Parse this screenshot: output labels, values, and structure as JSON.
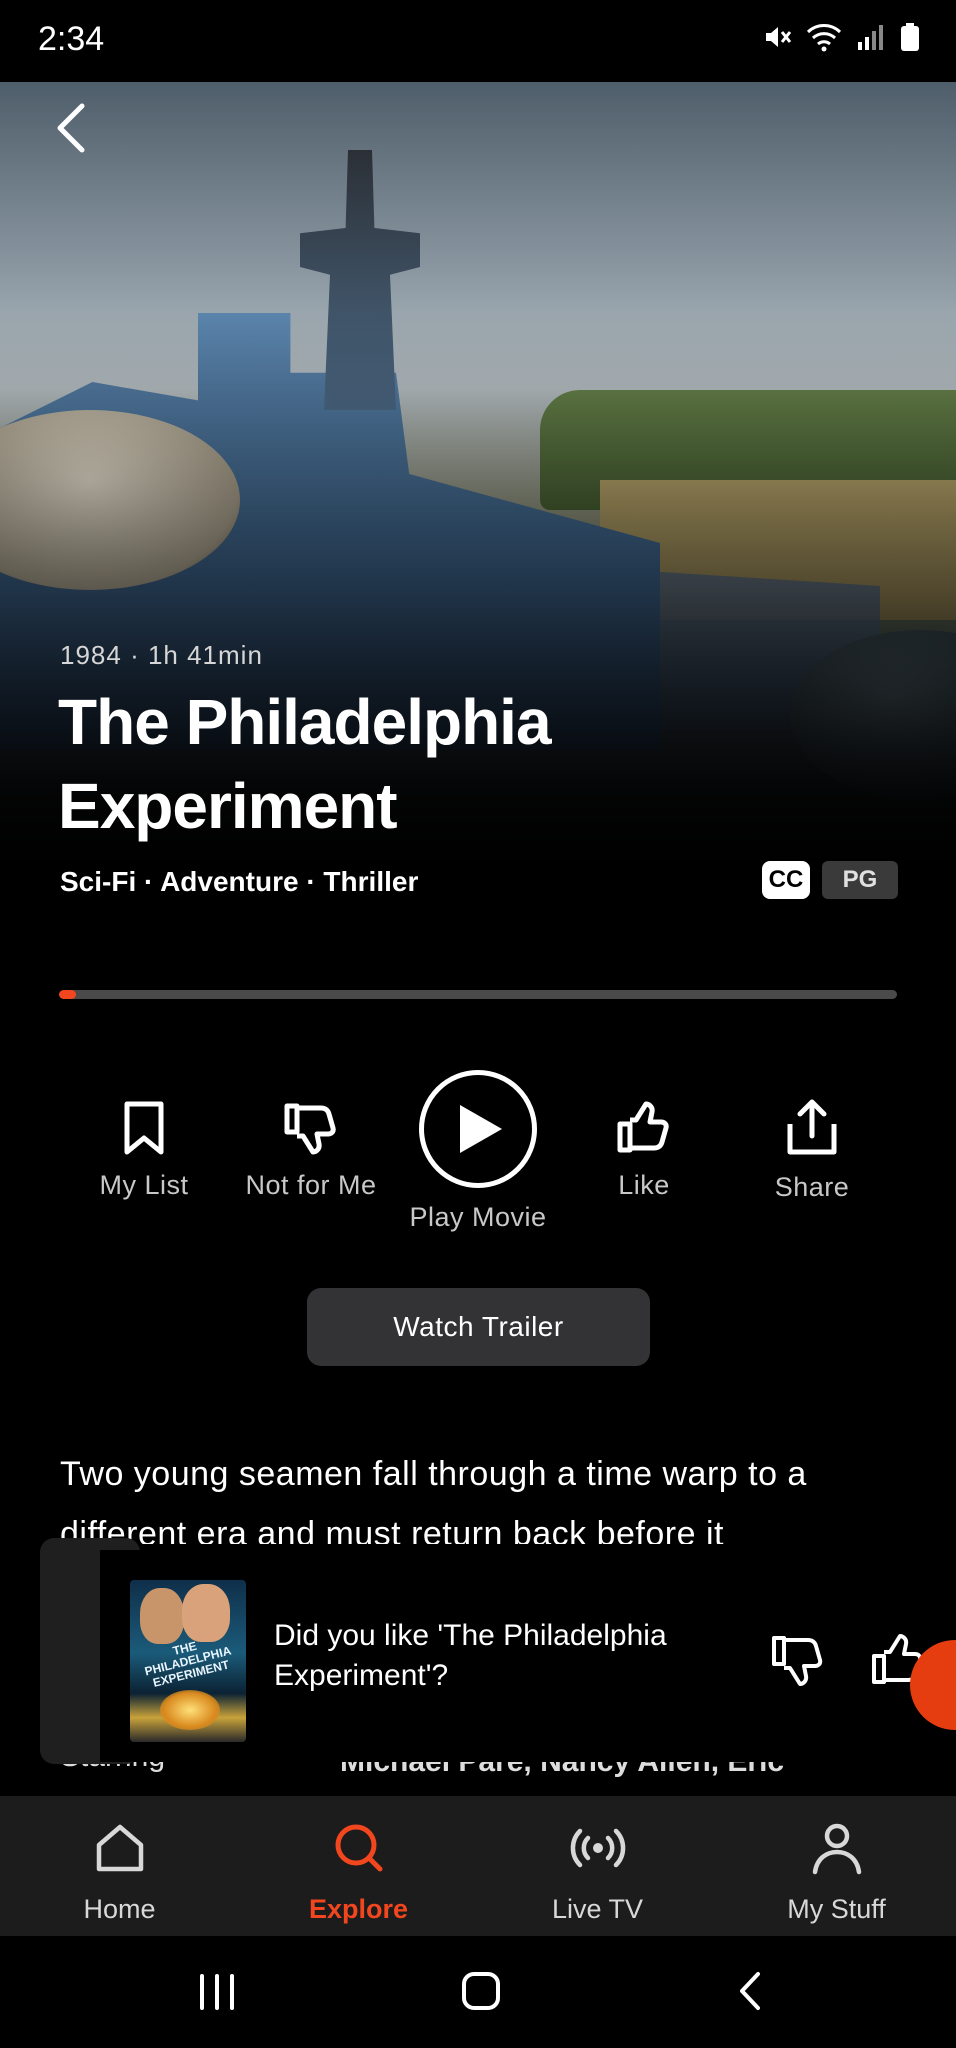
{
  "status_bar": {
    "time": "2:34",
    "icons": [
      "mute-icon",
      "wifi-icon",
      "signal-icon",
      "battery-icon"
    ]
  },
  "movie": {
    "meta": "1984 · 1h 41min",
    "title": "The Philadelphia Experiment",
    "genres": "Sci-Fi · Adventure · Thriller",
    "badges": {
      "cc": "CC",
      "rating": "PG"
    },
    "progress_percent": 2,
    "description": "Two young seamen fall through a time warp to a different era and must return back before it"
  },
  "actions": {
    "my_list": "My List",
    "not_for_me": "Not for Me",
    "play": "Play Movie",
    "like": "Like",
    "share": "Share"
  },
  "trailer_button": "Watch Trailer",
  "cast": {
    "label": "Starring",
    "value": "Michael Paré, Nancy Allen, Eric"
  },
  "rating_prompt": {
    "question": "Did you like 'The Philadelphia Experiment'?",
    "poster_title": "THE PHILADELPHIA EXPERIMENT"
  },
  "bottom_nav": {
    "items": [
      {
        "label": "Home",
        "icon": "home-icon"
      },
      {
        "label": "Explore",
        "icon": "search-icon",
        "active": true
      },
      {
        "label": "Live TV",
        "icon": "broadcast-icon"
      },
      {
        "label": "My Stuff",
        "icon": "profile-icon"
      }
    ]
  },
  "colors": {
    "accent": "#f2461e",
    "background": "#000000",
    "nav_background": "#1c1c1c"
  }
}
